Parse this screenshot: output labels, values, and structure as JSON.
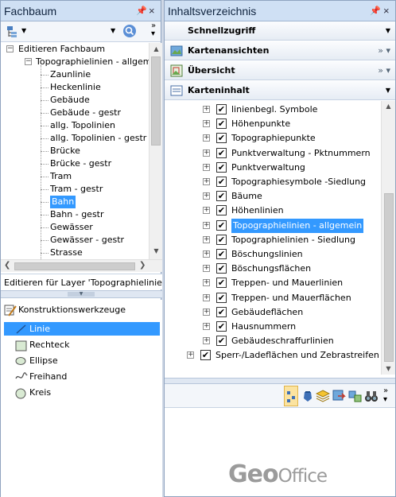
{
  "left": {
    "title": "Fachbaum",
    "pin": "↓",
    "close": "×",
    "tree_root": "Editieren Fachbaum",
    "tree_group": "Topographielinien - allgem",
    "tree_items": [
      "Zaunlinie",
      "Heckenlinie",
      "Gebäude",
      "Gebäude - gestr",
      "allg. Topolinien",
      "allg. Topolinien - gestr",
      "Brücke",
      "Brücke - gestr",
      "Tram",
      "Tram - gestr",
      "Bahn",
      "Bahn - gestr",
      "Gewässer",
      "Gewässer - gestr",
      "Strasse"
    ],
    "selected_item": "Bahn",
    "layer_label": "Editieren für Layer 'Topographielinie...",
    "tools_title": "Konstruktionswerkzeuge",
    "tools": [
      "Linie",
      "Rechteck",
      "Ellipse",
      "Freihand",
      "Kreis"
    ],
    "active_tool": "Linie"
  },
  "right": {
    "title": "Inhaltsverzeichnis",
    "pin": "↓",
    "close": "×",
    "sections": {
      "quick": "Schnellzugriff",
      "maps": "Kartenansichten",
      "overview": "Übersicht",
      "content": "Karteninhalt"
    },
    "layers": [
      "linienbegl. Symbole",
      "Höhenpunkte",
      "Topographiepunkte",
      "Punktverwaltung - Pktnummern",
      "Punktverwaltung",
      "Topographiesymbole -Siedlung",
      "Bäume",
      "Höhenlinien",
      "Topographielinien - allgemein",
      "Topographielinien - Siedlung",
      "Böschungslinien",
      "Böschungsflächen",
      "Treppen- und Mauerlinien",
      "Treppen- und Mauerflächen",
      "Gebäudeflächen",
      "Hausnummern",
      "Gebäudeschraffurlinien"
    ],
    "selected_layer": "Topographielinien - allgemein",
    "last_layer": "Sperr-/Ladeflächen und Zebrastreifen",
    "logo_geo": "Geo",
    "logo_office": "Office"
  },
  "colors": {
    "selection": "#3399ff",
    "title_bg": "#cfe0f4",
    "check": "#000000"
  }
}
